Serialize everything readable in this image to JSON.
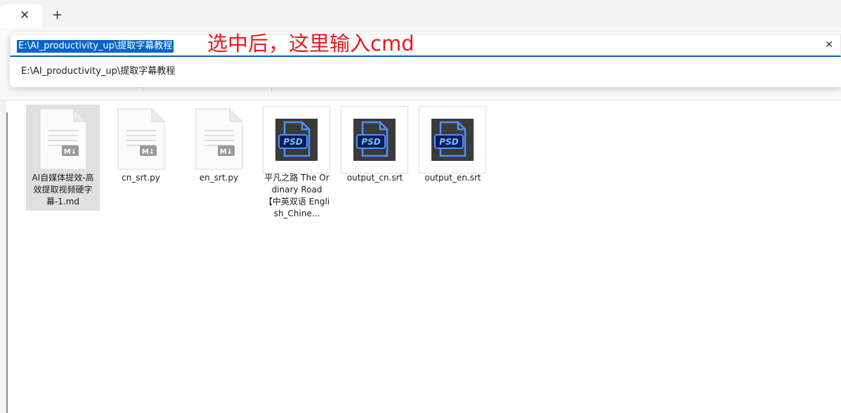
{
  "tabs": {
    "close_icon": "close-icon",
    "new_tab_label": "+"
  },
  "address": {
    "selected_path": "E:\\AI_productivity_up\\提取字幕教程",
    "annotation": "选中后，这里输入cmd",
    "annotation_color": "#e8191c",
    "selection_color": "#0a64c8",
    "clear_icon": "✕",
    "suggestion": "E:\\AI_productivity_up\\提取字幕教程"
  },
  "files": [
    {
      "name": "AI自媒体提效-高效提取视频硬字幕-1.md",
      "icon": "markdown-file-icon",
      "selected": true
    },
    {
      "name": "cn_srt.py",
      "icon": "python-file-icon",
      "selected": false
    },
    {
      "name": "en_srt.py",
      "icon": "python-file-icon",
      "selected": false
    },
    {
      "name": "平凡之路 The Ordinary Road 【中英双语 English_Chine...",
      "icon": "psd-icon",
      "selected": false
    },
    {
      "name": "output_cn.srt",
      "icon": "psd-icon",
      "selected": false
    },
    {
      "name": "output_en.srt",
      "icon": "psd-icon",
      "selected": false
    }
  ],
  "icons": {
    "psd_text": "PSD",
    "md_badge": "M↓"
  }
}
